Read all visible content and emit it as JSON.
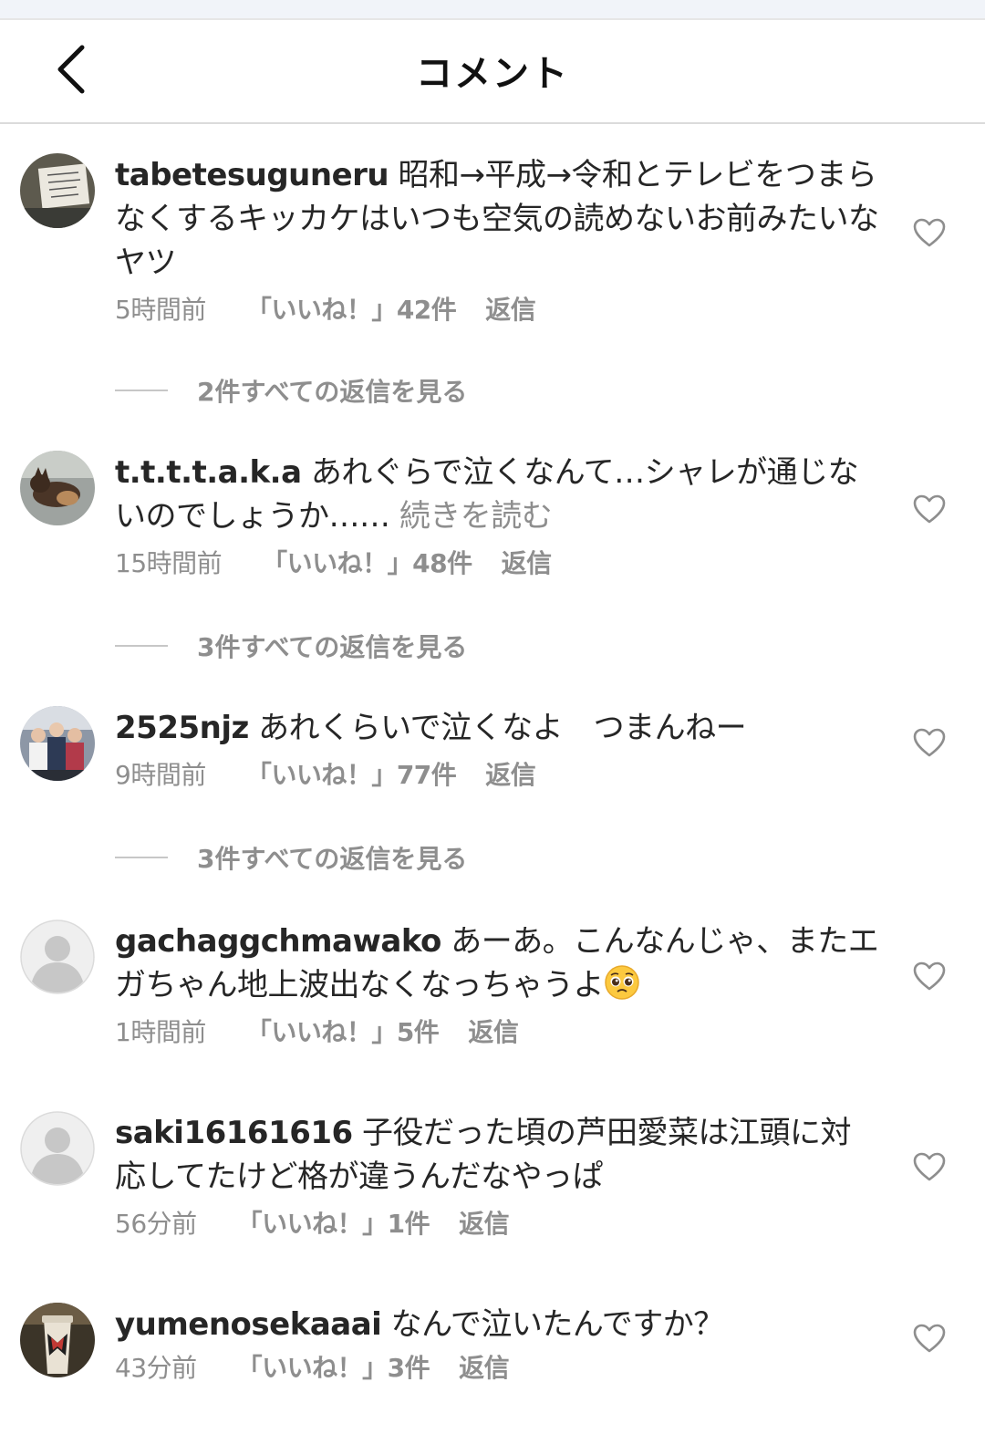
{
  "header": {
    "title": "コメント"
  },
  "comments": [
    {
      "username": "tabetesuguneru",
      "text": "昭和→平成→令和とテレビをつまらなくするキッカケはいつも空気の読めないお前みたいなヤツ",
      "more": "",
      "time": "5時間前",
      "likes": "「いいね！」42件",
      "reply": "返信",
      "view_replies": "2件すべての返信を見る",
      "avatar": "photo-sign"
    },
    {
      "username": "t.t.t.t.a.k.a",
      "text": "あれぐらで泣くなんて…シャレが通じないのでしょうか……",
      "more": "続きを読む",
      "time": "15時間前",
      "likes": "「いいね！」48件",
      "reply": "返信",
      "view_replies": "3件すべての返信を見る",
      "avatar": "photo-dog"
    },
    {
      "username": "2525njz",
      "text": "あれくらいで泣くなよ　つまんねー",
      "more": "",
      "time": "9時間前",
      "likes": "「いいね！」77件",
      "reply": "返信",
      "view_replies": "3件すべての返信を見る",
      "avatar": "photo-group"
    },
    {
      "username": "gachaggchmawako",
      "text": "あーあ。こんなんじゃ、またエガちゃん地上波出なくなっちゃうよ",
      "more": "",
      "time": "1時間前",
      "likes": "「いいね！」5件",
      "reply": "返信",
      "view_replies": "",
      "avatar": "default-avatar",
      "emoji": "pleading-face-icon"
    },
    {
      "username": "saki16161616",
      "text": "子役だった頃の芦田愛菜は江頭に対応してたけど格が違うんだなやっぱ",
      "more": "",
      "time": "56分前",
      "likes": "「いいね！」1件",
      "reply": "返信",
      "view_replies": "",
      "avatar": "default-avatar"
    },
    {
      "username": "yumenosekaaai",
      "text": "なんで泣いたんですか？",
      "more": "",
      "time": "43分前",
      "likes": "「いいね！」3件",
      "reply": "返信",
      "view_replies": "",
      "avatar": "photo-cup"
    }
  ],
  "colors": {
    "text": "#262626",
    "secondary": "#8e8e8e",
    "divider": "#dbdbdb"
  }
}
